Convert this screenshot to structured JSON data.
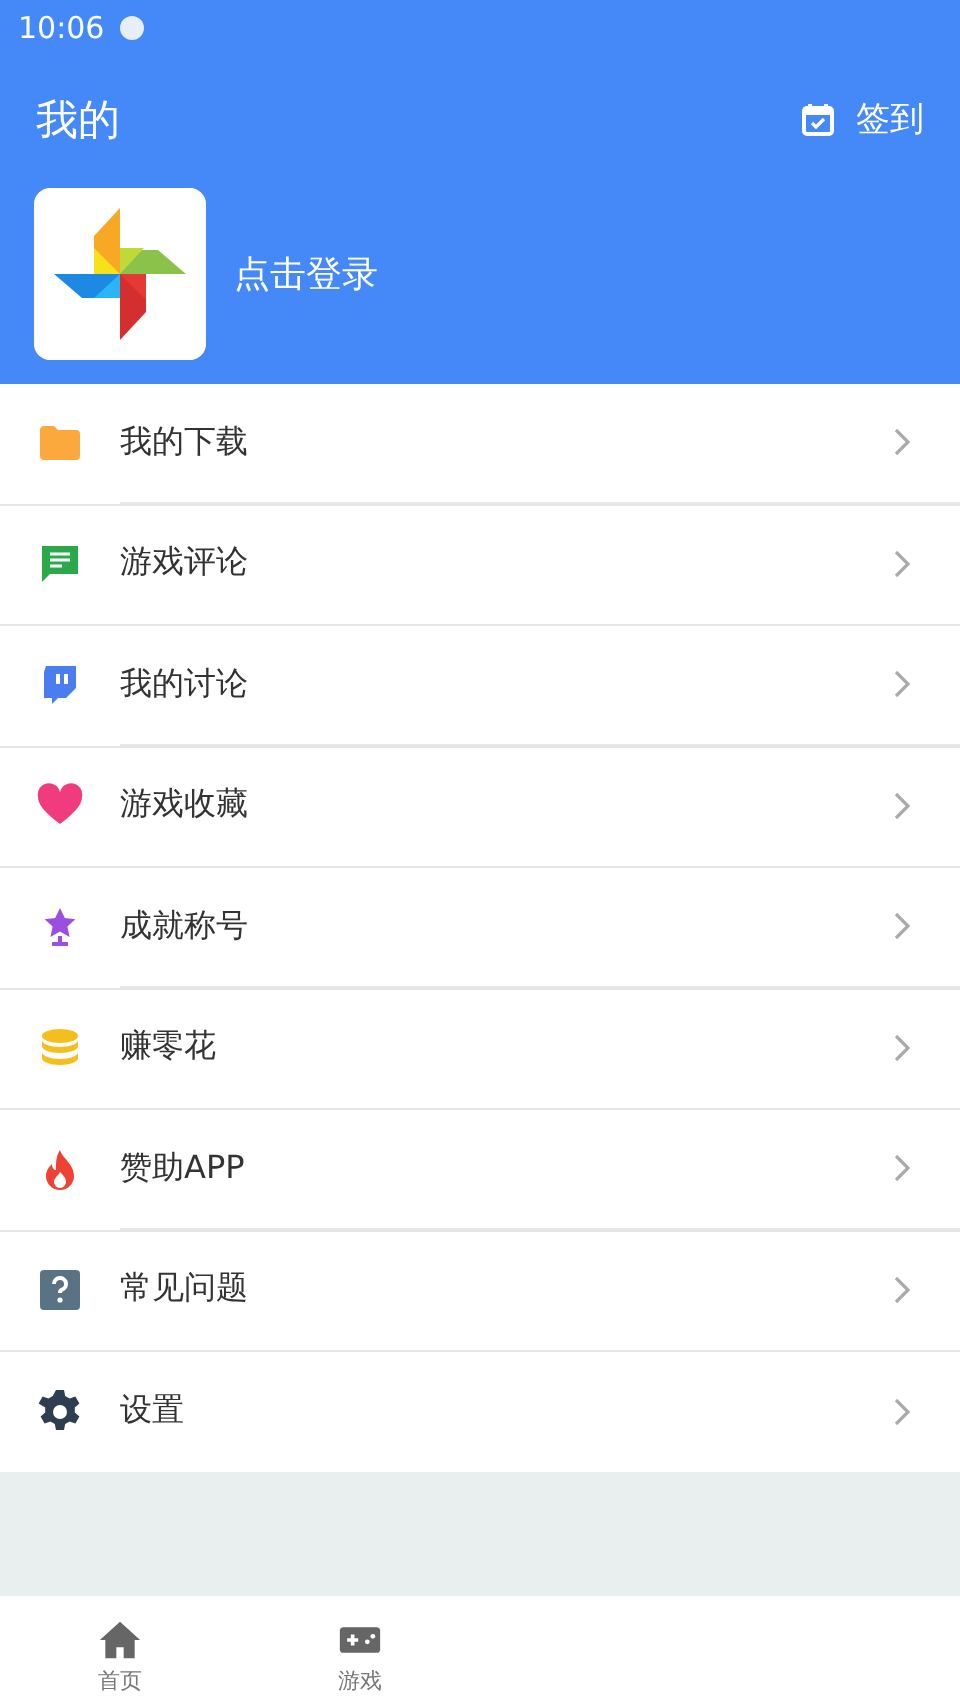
{
  "status_bar": {
    "time": "10:06"
  },
  "header": {
    "title": "我的",
    "checkin": "签到",
    "login": "点击登录"
  },
  "menu": [
    {
      "kind": "folder",
      "label": "我的下载"
    },
    {
      "kind": "comment",
      "label": "游戏评论"
    },
    {
      "kind": "discussion",
      "label": "我的讨论"
    },
    {
      "kind": "heart",
      "label": "游戏收藏"
    },
    {
      "kind": "trophy",
      "label": "成就称号"
    },
    {
      "kind": "coins",
      "label": "赚零花"
    },
    {
      "kind": "flame",
      "label": "赞助APP"
    },
    {
      "kind": "help",
      "label": "常见问题"
    },
    {
      "kind": "settings",
      "label": "设置"
    }
  ],
  "bottom_nav": [
    {
      "kind": "home",
      "label": "首页",
      "selected": false
    },
    {
      "kind": "game",
      "label": "游戏",
      "selected": false
    }
  ]
}
